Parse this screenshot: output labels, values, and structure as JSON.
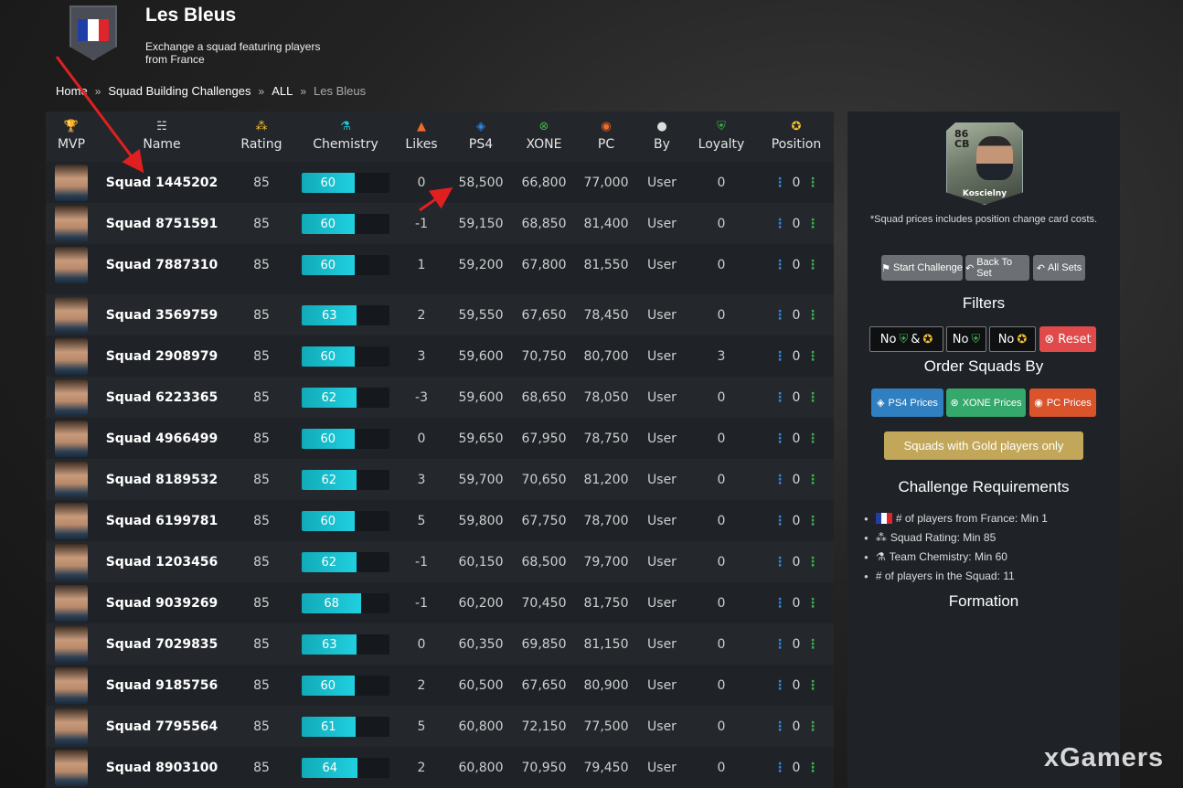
{
  "header": {
    "title": "Les Bleus",
    "subtitle": "Exchange a squad featuring players from France",
    "flag_colors": [
      "#1f3fa6",
      "#ffffff",
      "#e0242c"
    ]
  },
  "breadcrumb": {
    "items": [
      "Home",
      "Squad Building Challenges",
      "ALL"
    ],
    "separator": "»",
    "current": "Les Bleus"
  },
  "table": {
    "columns": [
      {
        "label": "MVP",
        "icon": "trophy-icon",
        "icon_color": "#f2c230"
      },
      {
        "label": "Name",
        "icon": "squad-icon",
        "icon_color": "#dddddd"
      },
      {
        "label": "Rating",
        "icon": "stars-icon",
        "icon_color": "#f2c230"
      },
      {
        "label": "Chemistry",
        "icon": "flask-icon",
        "icon_color": "#1ec8d8"
      },
      {
        "label": "Likes",
        "icon": "fire-icon",
        "icon_color": "#f26a2a"
      },
      {
        "label": "PS4",
        "icon": "playstation-icon",
        "icon_color": "#2e86de"
      },
      {
        "label": "XONE",
        "icon": "xbox-icon",
        "icon_color": "#3cb04a"
      },
      {
        "label": "PC",
        "icon": "origin-icon",
        "icon_color": "#f06a2a"
      },
      {
        "label": "By",
        "icon": "user-icon",
        "icon_color": "#dddddd"
      },
      {
        "label": "Loyalty",
        "icon": "shield-icon",
        "icon_color": "#3cb04a"
      },
      {
        "label": "Position",
        "icon": "medal-icon",
        "icon_color": "#f2c230"
      }
    ],
    "rows": [
      {
        "name": "Squad 1445202",
        "rating": "85",
        "chemistry": 60,
        "chemistry_label": "60",
        "likes": "0",
        "ps4": "58,500",
        "xone": "66,800",
        "pc": "77,000",
        "by": "User",
        "loyalty": "0",
        "position": "0"
      },
      {
        "name": "Squad 8751591",
        "rating": "85",
        "chemistry": 60,
        "chemistry_label": "60",
        "likes": "-1",
        "ps4": "59,150",
        "xone": "68,850",
        "pc": "81,400",
        "by": "User",
        "loyalty": "0",
        "position": "0"
      },
      {
        "name": "Squad 7887310",
        "rating": "85",
        "chemistry": 60,
        "chemistry_label": "60",
        "likes": "1",
        "ps4": "59,200",
        "xone": "67,800",
        "pc": "81,550",
        "by": "User",
        "loyalty": "0",
        "position": "0"
      },
      {
        "name": "Squad 3569759",
        "rating": "85",
        "chemistry": 63,
        "chemistry_label": "63",
        "likes": "2",
        "ps4": "59,550",
        "xone": "67,650",
        "pc": "78,450",
        "by": "User",
        "loyalty": "0",
        "position": "0"
      },
      {
        "name": "Squad 2908979",
        "rating": "85",
        "chemistry": 60,
        "chemistry_label": "60",
        "likes": "3",
        "ps4": "59,600",
        "xone": "70,750",
        "pc": "80,700",
        "by": "User",
        "loyalty": "3",
        "position": "0"
      },
      {
        "name": "Squad 6223365",
        "rating": "85",
        "chemistry": 62,
        "chemistry_label": "62",
        "likes": "-3",
        "ps4": "59,600",
        "xone": "68,650",
        "pc": "78,050",
        "by": "User",
        "loyalty": "0",
        "position": "0"
      },
      {
        "name": "Squad 4966499",
        "rating": "85",
        "chemistry": 60,
        "chemistry_label": "60",
        "likes": "0",
        "ps4": "59,650",
        "xone": "67,950",
        "pc": "78,750",
        "by": "User",
        "loyalty": "0",
        "position": "0"
      },
      {
        "name": "Squad 8189532",
        "rating": "85",
        "chemistry": 62,
        "chemistry_label": "62",
        "likes": "3",
        "ps4": "59,700",
        "xone": "70,650",
        "pc": "81,200",
        "by": "User",
        "loyalty": "0",
        "position": "0"
      },
      {
        "name": "Squad 6199781",
        "rating": "85",
        "chemistry": 60,
        "chemistry_label": "60",
        "likes": "5",
        "ps4": "59,800",
        "xone": "67,750",
        "pc": "78,700",
        "by": "User",
        "loyalty": "0",
        "position": "0"
      },
      {
        "name": "Squad 1203456",
        "rating": "85",
        "chemistry": 62,
        "chemistry_label": "62",
        "likes": "-1",
        "ps4": "60,150",
        "xone": "68,500",
        "pc": "79,700",
        "by": "User",
        "loyalty": "0",
        "position": "0"
      },
      {
        "name": "Squad 9039269",
        "rating": "85",
        "chemistry": 68,
        "chemistry_label": "68",
        "likes": "-1",
        "ps4": "60,200",
        "xone": "70,450",
        "pc": "81,750",
        "by": "User",
        "loyalty": "0",
        "position": "0"
      },
      {
        "name": "Squad 7029835",
        "rating": "85",
        "chemistry": 63,
        "chemistry_label": "63",
        "likes": "0",
        "ps4": "60,350",
        "xone": "69,850",
        "pc": "81,150",
        "by": "User",
        "loyalty": "0",
        "position": "0"
      },
      {
        "name": "Squad 9185756",
        "rating": "85",
        "chemistry": 60,
        "chemistry_label": "60",
        "likes": "2",
        "ps4": "60,500",
        "xone": "67,650",
        "pc": "80,900",
        "by": "User",
        "loyalty": "0",
        "position": "0"
      },
      {
        "name": "Squad 7795564",
        "rating": "85",
        "chemistry": 61,
        "chemistry_label": "61",
        "likes": "5",
        "ps4": "60,800",
        "xone": "72,150",
        "pc": "77,500",
        "by": "User",
        "loyalty": "0",
        "position": "0"
      },
      {
        "name": "Squad 8903100",
        "rating": "85",
        "chemistry": 64,
        "chemistry_label": "64",
        "likes": "2",
        "ps4": "60,800",
        "xone": "70,950",
        "pc": "79,450",
        "by": "User",
        "loyalty": "0",
        "position": "0"
      }
    ]
  },
  "sidebar": {
    "player_card": {
      "rating": "86",
      "position": "CB",
      "name": "Koscielny"
    },
    "price_note": "*Squad prices includes position change card costs.",
    "buttons": {
      "start": "Start Challenge",
      "back": "Back To Set",
      "all": "All Sets"
    },
    "filters_title": "Filters",
    "filters": {
      "f1_prefix": "No",
      "f1_amp": "&",
      "f2_prefix": "No",
      "f3_prefix": "No",
      "reset": "Reset"
    },
    "order_title": "Order Squads By",
    "order": {
      "ps4": "PS4 Prices",
      "xone": "XONE Prices",
      "pc": "PC Prices"
    },
    "gold_button": "Squads with Gold players only",
    "requirements_title": "Challenge Requirements",
    "requirements": [
      "# of players from France: Min 1",
      "Squad Rating: Min 85",
      "Team Chemistry: Min 60",
      "# of players in the Squad: 11"
    ],
    "formation_title": "Formation"
  },
  "colors": {
    "ps4": "#2f7fc1",
    "xone": "#35a86b",
    "pc": "#d9532b",
    "reset": "#e14a4a",
    "gold": "#c2a75a",
    "chemistry": "#20d0e0",
    "annotation_arrow": "#e02020"
  },
  "watermark": "xGamers"
}
